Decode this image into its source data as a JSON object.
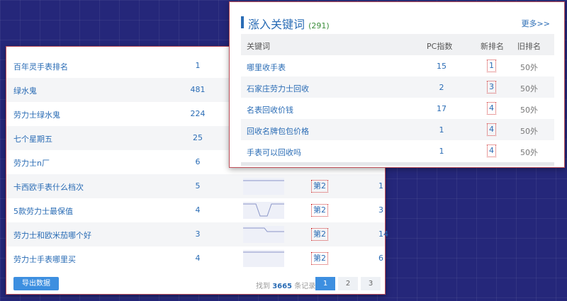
{
  "back_table": {
    "rows": [
      {
        "keyword": "百年灵手表排名",
        "pc": "1"
      },
      {
        "keyword": "绿水鬼",
        "pc": "481"
      },
      {
        "keyword": "劳力士绿水鬼",
        "pc": "224"
      },
      {
        "keyword": "七个星期五",
        "pc": "25"
      },
      {
        "keyword": "劳力士n厂",
        "pc": "6"
      },
      {
        "keyword": "卡西欧手表什么档次",
        "pc": "5",
        "rank": "第2",
        "old": "1"
      },
      {
        "keyword": "5款劳力士最保值",
        "pc": "4",
        "rank": "第2",
        "old": "3"
      },
      {
        "keyword": "劳力士和欧米茄哪个好",
        "pc": "3",
        "rank": "第2",
        "old": "14"
      },
      {
        "keyword": "劳力士手表哪里买",
        "pc": "4",
        "rank": "第2",
        "old": "6"
      }
    ],
    "export_label": "导出数据",
    "found_prefix": "找到",
    "found_count": "3665",
    "found_suffix": "条记录",
    "pages": [
      "1",
      "2",
      "3"
    ]
  },
  "rising_panel": {
    "title": "涨入关键词",
    "count": "(291)",
    "more": "更多>>",
    "headers": {
      "keyword": "关键词",
      "pc": "PC指数",
      "new_rank": "新排名",
      "old_rank": "旧排名"
    },
    "rows": [
      {
        "keyword": "哪里收手表",
        "pc": "15",
        "new": "1",
        "old": "50外"
      },
      {
        "keyword": "石家庄劳力士回收",
        "pc": "2",
        "new": "3",
        "old": "50外"
      },
      {
        "keyword": "名表回收价钱",
        "pc": "17",
        "new": "4",
        "old": "50外"
      },
      {
        "keyword": "回收名牌包包价格",
        "pc": "1",
        "new": "4",
        "old": "50外"
      },
      {
        "keyword": "手表可以回收吗",
        "pc": "1",
        "new": "4",
        "old": "50外"
      }
    ]
  },
  "colors": {
    "accent": "#2a6cb5",
    "button": "#3d8fe0",
    "rank_border": "#d23a3a",
    "count": "#3a8d3a"
  }
}
